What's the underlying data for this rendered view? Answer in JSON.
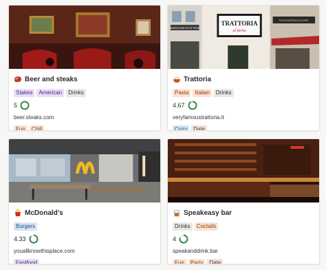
{
  "cards": [
    {
      "title": "Beer and steaks",
      "emoji": "steak-icon",
      "cuisine": [
        {
          "label": "Stakes",
          "tone": "purple"
        },
        {
          "label": "American",
          "tone": "purple"
        },
        {
          "label": "Drinks",
          "tone": "gray"
        }
      ],
      "rating": "5",
      "rating_fraction": 1.0,
      "url": "beer.steaks.com",
      "vibe": [
        {
          "label": "Fun",
          "tone": "orange"
        },
        {
          "label": "Chill",
          "tone": "orange"
        }
      ]
    },
    {
      "title": "Trattoria",
      "emoji": "pasta-icon",
      "cuisine": [
        {
          "label": "Pasta",
          "tone": "orange"
        },
        {
          "label": "Italian",
          "tone": "orange"
        },
        {
          "label": "Drinks",
          "tone": "gray"
        }
      ],
      "rating": "4.67",
      "rating_fraction": 0.93,
      "url": "veryfamoustrattoria.it",
      "vibe": [
        {
          "label": "Cozy",
          "tone": "blue"
        },
        {
          "label": "Date",
          "tone": "brown"
        }
      ]
    },
    {
      "title": "McDonald's",
      "emoji": "fries-icon",
      "cuisine": [
        {
          "label": "Burgers",
          "tone": "blue"
        }
      ],
      "rating": "4.33",
      "rating_fraction": 0.87,
      "url": "youallknowthisplace.com",
      "vibe": [
        {
          "label": "Fastfood",
          "tone": "purple"
        }
      ]
    },
    {
      "title": "Speakeasy bar",
      "emoji": "whiskey-icon",
      "cuisine": [
        {
          "label": "Drinks",
          "tone": "gray"
        },
        {
          "label": "Coctails",
          "tone": "orange"
        }
      ],
      "rating": "4",
      "rating_fraction": 0.8,
      "url": "speakanddrink.bar",
      "vibe": [
        {
          "label": "Fun",
          "tone": "orange"
        },
        {
          "label": "Party",
          "tone": "orange"
        },
        {
          "label": "Date",
          "tone": "brown"
        }
      ]
    }
  ],
  "photo_signs": {
    "trattoria_sign": "TRATTORIA",
    "trattoria_script": "al forno",
    "pizza_sign": "NEAPOLITAN STYLE PIZZA",
    "elixir_sign": "ENCHANTING ELIXIRS"
  },
  "colors": {
    "ring": "#3b8a4f",
    "ring_track": "#d9ead9"
  }
}
